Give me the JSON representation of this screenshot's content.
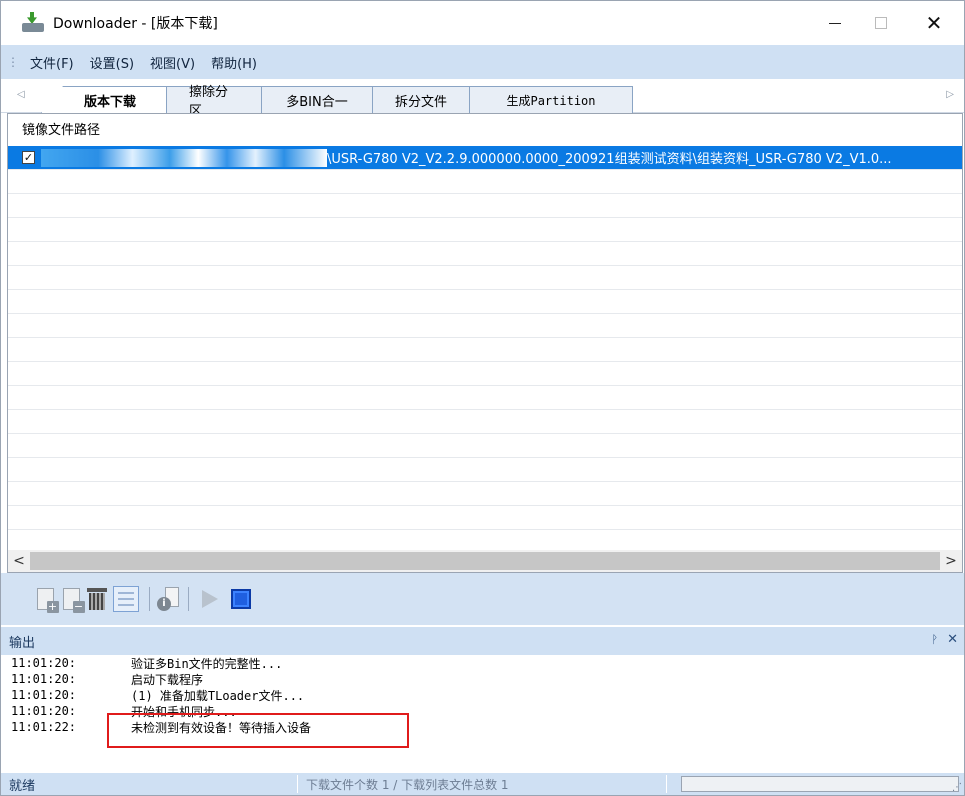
{
  "window": {
    "title": "Downloader - [版本下载]",
    "controls": {
      "minimize": "",
      "maximize": "",
      "close": "✕"
    }
  },
  "menu": {
    "items": [
      "文件(F)",
      "设置(S)",
      "视图(V)",
      "帮助(H)"
    ]
  },
  "tabs": {
    "left_arrow": "◁",
    "right_arrow": "▷",
    "items": [
      "版本下载",
      "擦除分区",
      "多BIN合一",
      "拆分文件",
      "生成Partition"
    ],
    "active": "版本下载"
  },
  "file_list": {
    "header": "镜像文件路径",
    "rows": [
      {
        "checked": true,
        "path_visible": "\\USR-G780 V2_V2.2.9.000000.0000_200921组装测试资料\\组装资料_USR-G780 V2_V1.0..."
      }
    ],
    "scroll_left": "<",
    "scroll_right": ">"
  },
  "toolbar": {
    "buttons": [
      "add-file-icon",
      "remove-file-icon",
      "trash-icon",
      "list-icon",
      "info-icon",
      "play-icon",
      "stop-icon"
    ]
  },
  "output": {
    "title": "输出",
    "pin": "ᚹ",
    "close": "✕",
    "lines": [
      {
        "time": "11:01:20:",
        "msg": "验证多Bin文件的完整性..."
      },
      {
        "time": "11:01:20:",
        "msg": "启动下载程序"
      },
      {
        "time": "11:01:20:",
        "msg": "(1) 准备加载TLoader文件..."
      },
      {
        "time": "11:01:20:",
        "msg": "开始和手机同步..."
      },
      {
        "time": "11:01:22:",
        "msg": "未检测到有效设备！等待插入设备"
      }
    ]
  },
  "status": {
    "ready": "就绪",
    "count": "下载文件个数 1 / 下载列表文件总数 1"
  },
  "colors": {
    "menu_bg": "#cfe0f3",
    "selection": "#0a7ae3",
    "highlight_border": "#e01b1b"
  }
}
